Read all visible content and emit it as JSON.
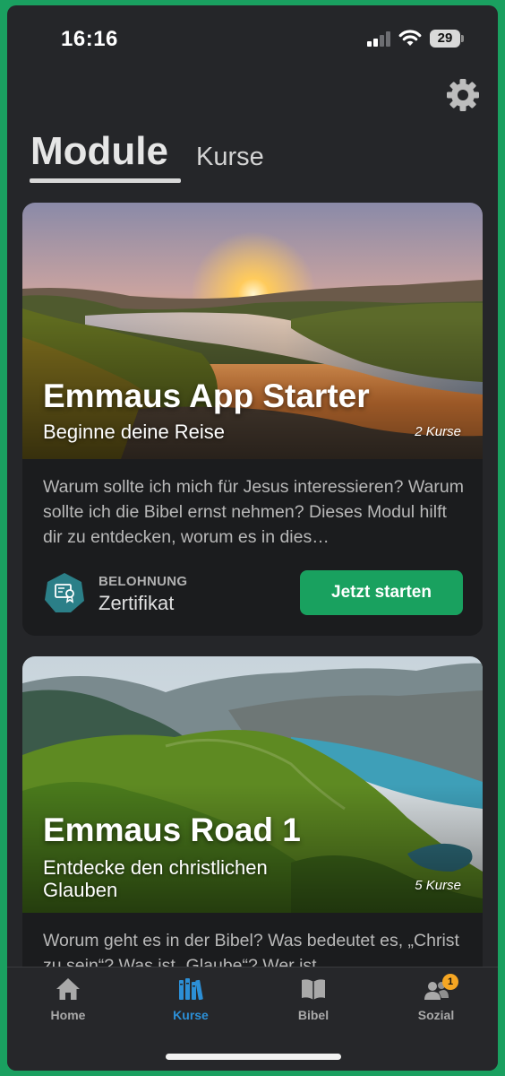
{
  "status_bar": {
    "time": "16:16",
    "battery": "29"
  },
  "header": {
    "active_tab": "Module",
    "inactive_tab": "Kurse"
  },
  "modules": [
    {
      "title": "Emmaus App Starter",
      "subtitle": "Beginne deine Reise",
      "course_count": "2 Kurse",
      "description": "Warum sollte ich mich für Jesus interessieren? Warum sollte ich die Bibel ernst nehmen? Dieses Modul hilft dir zu entdecken, worum es in dies…",
      "reward_label": "BELOHNUNG",
      "reward_value": "Zertifikat",
      "cta": "Jetzt starten"
    },
    {
      "title": "Emmaus Road 1",
      "subtitle": "Entdecke den christlichen Glauben",
      "course_count": "5 Kurse",
      "description": "Worum geht es in der Bibel? Was bedeutet es, „Christ zu sein“? Was ist „Glaube“? Wer ist"
    }
  ],
  "tab_bar": {
    "items": [
      {
        "label": "Home",
        "icon": "home-icon"
      },
      {
        "label": "Kurse",
        "icon": "books-icon",
        "active": true
      },
      {
        "label": "Bibel",
        "icon": "bible-icon"
      },
      {
        "label": "Sozial",
        "icon": "people-icon",
        "badge": "1"
      }
    ]
  },
  "colors": {
    "accent_green": "#19a15f",
    "active_tab_blue": "#2c8fd6",
    "badge_orange": "#f5a623",
    "background": "#252629"
  }
}
